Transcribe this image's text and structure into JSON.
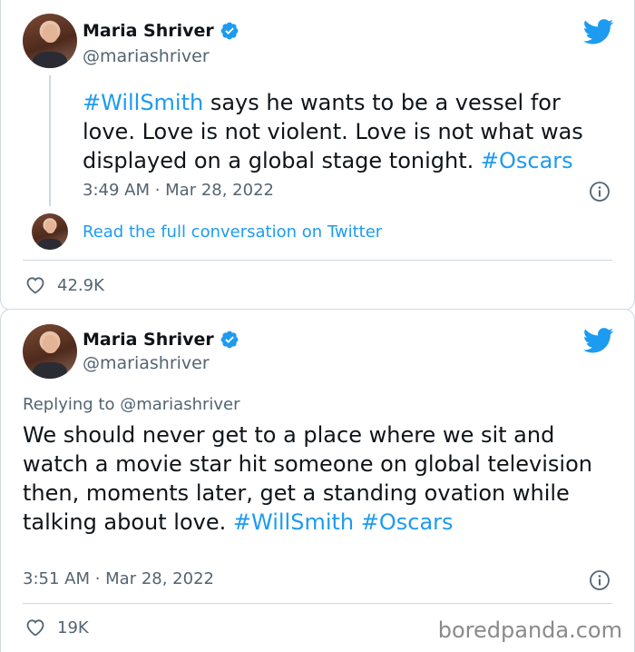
{
  "tweets": [
    {
      "author": {
        "name": "Maria Shriver",
        "handle": "@mariashriver"
      },
      "text_parts": [
        {
          "text": "#WillSmith",
          "tag": true
        },
        {
          "text": " says he wants to be a vessel for love. Love is not violent. Love is not what was displayed on a global stage tonight. ",
          "tag": false
        },
        {
          "text": "#Oscars",
          "tag": true
        }
      ],
      "timestamp": "3:49 AM · Mar 28, 2022",
      "read_conversation": "Read the full conversation on Twitter",
      "likes": "42.9K"
    },
    {
      "author": {
        "name": "Maria Shriver",
        "handle": "@mariashriver"
      },
      "replying_prefix": "Replying to ",
      "replying_handle": "@mariashriver",
      "text_parts": [
        {
          "text": "We should never get to a place where we sit and watch a movie star hit someone on global television then, moments later, get a standing ovation while talking about love. ",
          "tag": false
        },
        {
          "text": "#WillSmith",
          "tag": true
        },
        {
          "text": " ",
          "tag": false
        },
        {
          "text": "#Oscars",
          "tag": true
        }
      ],
      "timestamp": "3:51 AM · Mar 28, 2022",
      "likes": "19K"
    }
  ],
  "watermark": "boredpanda.com",
  "colors": {
    "accent": "#1d9bf0",
    "text": "#0f1419",
    "muted": "#536471",
    "border": "#cfd9de"
  },
  "icons": [
    "twitter-bird-icon",
    "verified-badge-icon",
    "info-icon",
    "heart-icon"
  ]
}
